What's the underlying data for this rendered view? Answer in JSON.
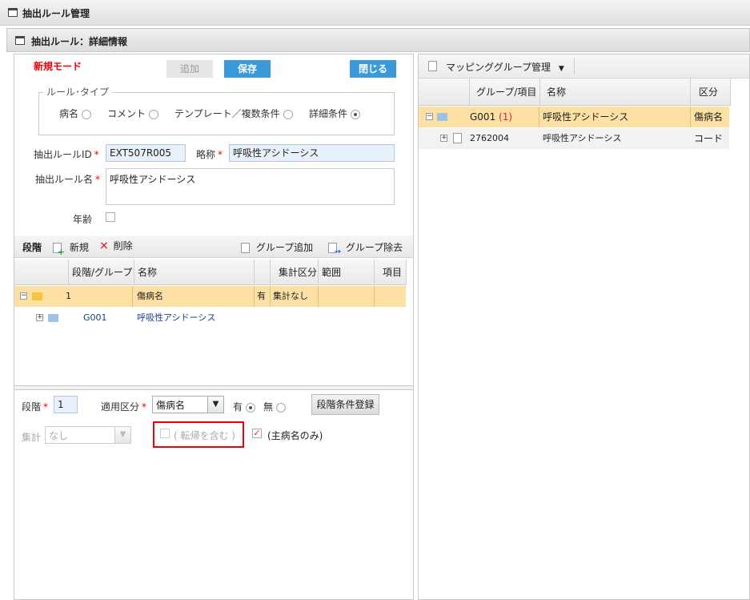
{
  "window": {
    "title": "抽出ルール管理"
  },
  "subwindow": {
    "title": "抽出ルール：詳細情報"
  },
  "form": {
    "mode_label": "新規モード",
    "add_label": "追加",
    "save_label": "保存",
    "close_label": "閉じる",
    "rule_type": {
      "legend": "ルール･タイプ",
      "options": [
        {
          "label": "病名",
          "selected": false
        },
        {
          "label": "コメント",
          "selected": false
        },
        {
          "label": "テンプレート／複数条件",
          "selected": false
        },
        {
          "label": "詳細条件",
          "selected": true
        }
      ]
    },
    "rule_id": {
      "label": "抽出ルールID",
      "value": "EXT507R005"
    },
    "short_name": {
      "label": "略称",
      "value": "呼吸性アシドーシス"
    },
    "rule_name": {
      "label": "抽出ルール名",
      "value": "呼吸性アシドーシス"
    },
    "age": {
      "label": "年齢",
      "checked": false
    },
    "required_mark": "*"
  },
  "stage_toolbar": {
    "title": "段階",
    "new_label": "新規",
    "delete_label": "削除",
    "group_add_label": "グループ追加",
    "group_remove_label": "グループ除去"
  },
  "stage_grid": {
    "columns": [
      "段階/グループ",
      "名称",
      "",
      "集計区分",
      "範囲",
      "項目"
    ],
    "rows": [
      {
        "stage": "1",
        "name": "傷病名",
        "flag": "有",
        "aggregate": "集計なし",
        "range": "",
        "item": ""
      },
      {
        "stage": "G001",
        "name": "呼吸性アシドーシス",
        "flag": "",
        "aggregate": "",
        "range": "",
        "item": ""
      }
    ]
  },
  "stage_editor": {
    "stage_label": "段階",
    "stage_value": "1",
    "apply_label": "適用区分",
    "apply_value": "傷病名",
    "yes_label": "有",
    "no_label": "無",
    "yes_selected": true,
    "register_label": "段階条件登録",
    "aggregate_label": "集計",
    "aggregate_value": "なし",
    "outcome_label": "( 転帰を含む )",
    "outcome_checked": false,
    "main_only_label": "(主病名のみ)",
    "main_only_checked": true
  },
  "mapping": {
    "title": "マッピンググループ管理",
    "columns": [
      "グループ/項目",
      "名称",
      "区分"
    ],
    "rows": [
      {
        "code": "G001",
        "count": "(1)",
        "name": "呼吸性アシドーシス",
        "kind": "傷病名"
      },
      {
        "code": "2762004",
        "count": "",
        "name": "呼吸性アシドーシス",
        "kind": "コード"
      }
    ]
  }
}
